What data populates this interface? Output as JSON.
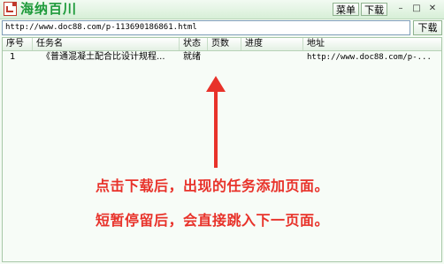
{
  "app": {
    "title": "海纳百川",
    "menu_label": "菜单",
    "download_label": "下载",
    "minimize_symbol": "–",
    "maximize_symbol": "□",
    "close_symbol": "✕"
  },
  "toolbar": {
    "url_value": "http://www.doc88.com/p-113690186861.html",
    "download_button_label": "下载"
  },
  "task_list": {
    "columns": [
      "序号",
      "任务名",
      "状态",
      "页数",
      "进度",
      "地址"
    ],
    "rows": [
      {
        "index": "1",
        "name": "《普通混凝土配合比设计规程...",
        "status": "就绪",
        "pages": "",
        "progress": "",
        "address": "http://www.doc88.com/p-..."
      }
    ]
  },
  "annotation": {
    "line1": "点击下载后，出现的任务添加页面。",
    "line2": "短暂停留后，会直接跳入下一页面。",
    "color": "#e8322a"
  },
  "icons": [
    "app-pdf-icon",
    "up-arrow-icon"
  ]
}
